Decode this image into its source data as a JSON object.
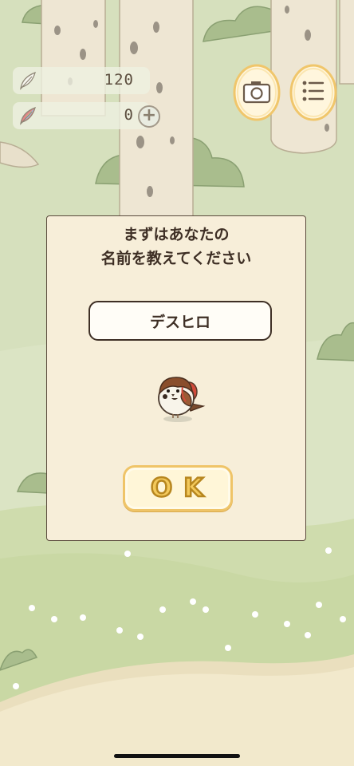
{
  "hud": {
    "feather_count": "120",
    "rainbow_feather_count": "0",
    "feather_icon": "feather-icon",
    "rainbow_feather_icon": "rainbow-feather-icon",
    "add_icon": "plus-icon",
    "add_label": "+",
    "camera_icon": "camera-icon",
    "menu_icon": "list-menu-icon"
  },
  "dialog": {
    "prompt": "まずはあなたの\n名前を教えてください",
    "name_value": "デスヒロ",
    "ok_label": "OK",
    "bird_icon": "sparrow-icon"
  },
  "colors": {
    "dialog_bg": "#f7eed9",
    "dialog_border": "#5a4a3c",
    "ok_fill": "#f3c95c",
    "ok_outline": "#b7861f",
    "ground": "#d9e3c2",
    "path": "#f1e7c8"
  }
}
